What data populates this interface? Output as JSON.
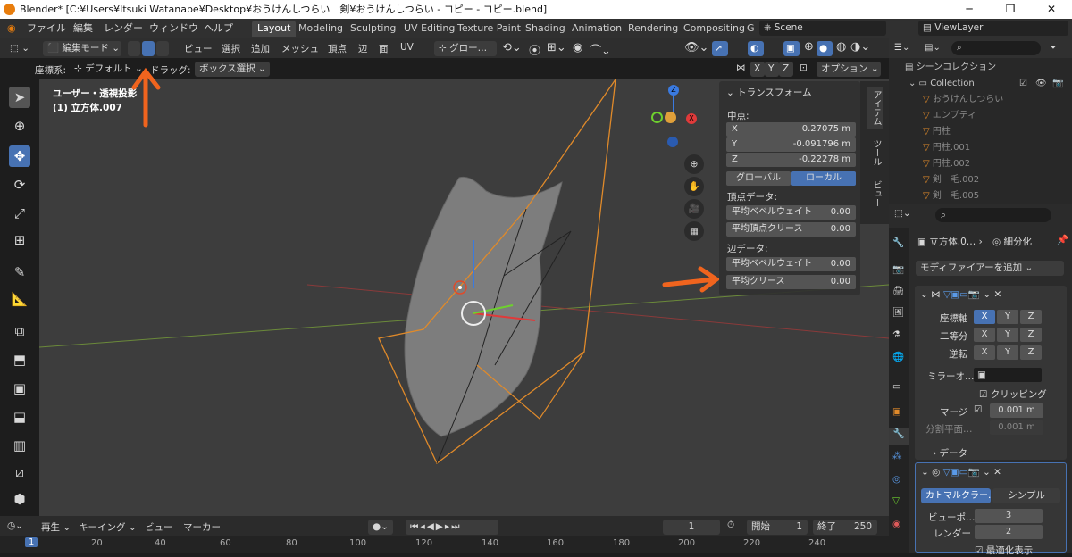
{
  "window": {
    "title": "Blender* [C:¥Users¥Itsuki Watanabe¥Desktop¥おうけんしつらい　剣¥おうけんしつらい - コピー - コピー.blend]",
    "minimize": "─",
    "maximize": "❐",
    "close": "✕"
  },
  "menu": {
    "items": [
      "ファイル",
      "編集",
      "レンダー",
      "ウィンドウ",
      "ヘルプ"
    ],
    "tabs": [
      "Layout",
      "Modeling",
      "Sculpting",
      "UV Editing",
      "Texture Paint",
      "Shading",
      "Animation",
      "Rendering",
      "Compositing",
      "G"
    ],
    "scene": "Scene",
    "view_layer": "ViewLayer"
  },
  "header": {
    "mode": "編集モード",
    "menus": [
      "ビュー",
      "選択",
      "追加",
      "メッシュ",
      "頂点",
      "辺",
      "面",
      "UV"
    ],
    "transform": "グロー…"
  },
  "subheader": {
    "coord_label": "座標系:",
    "coord_value": "デフォルト",
    "drag_label": "ドラッグ:",
    "drag_value": "ボックス選択",
    "axes": [
      "X",
      "Y",
      "Z"
    ],
    "options": "オプション"
  },
  "viewport": {
    "view_name": "ユーザー・透視投影",
    "object_name": "(1) 立方体.007",
    "gizmo": {
      "x": "X",
      "y": "Y",
      "z": "Z"
    }
  },
  "transform_panel": {
    "title": "トランスフォーム",
    "median_label": "中点:",
    "x_label": "X",
    "x": "0.27075 m",
    "y_label": "Y",
    "y": "-0.091796 m",
    "z_label": "Z",
    "z": "-0.22278 m",
    "global": "グローバル",
    "local": "ローカル",
    "vertex_data": "頂点データ:",
    "vert_bevel_label": "平均ベベルウェイト",
    "vert_bevel": "0.00",
    "vert_crease_label": "平均頂点クリース",
    "vert_crease": "0.00",
    "edge_data": "辺データ:",
    "edge_bevel_label": "平均ベベルウェイト",
    "edge_bevel": "0.00",
    "edge_crease_label": "平均クリース",
    "edge_crease": "0.00"
  },
  "side_tabs": [
    "アイテム",
    "ツール",
    "ビュー"
  ],
  "outliner": {
    "scene_collection": "シーンコレクション",
    "collection": "Collection",
    "items": [
      "おうけんしつらい",
      "エンプティ",
      "円柱",
      "円柱.001",
      "円柱.002",
      "剣　毛.002",
      "剣　毛.005"
    ]
  },
  "properties": {
    "object": "立方体.0…",
    "modifier_name": "細分化",
    "add_modifier": "モディファイアーを追加",
    "axis_label": "座標軸",
    "bisect_label": "二等分",
    "flip_label": "逆転",
    "mirror_obj_label": "ミラーオ…",
    "clipping": "クリッピング",
    "merge_label": "マージ",
    "merge": "0.001 m",
    "bisect_dist_label": "分割平面…",
    "bisect_dist": "0.001 m",
    "data_label": "データ",
    "catmull": "カトマルクラー…",
    "simple": "シンプル",
    "viewport_label": "ビューポ…",
    "viewport_levels": "3",
    "render_label": "レンダー",
    "render_levels": "2",
    "optimal": "最適化表示"
  },
  "timeline": {
    "playback": "再生",
    "keying": "キーイング",
    "view": "ビュー",
    "marker": "マーカー",
    "current_frame": "1",
    "start_label": "開始",
    "start": "1",
    "end_label": "終了",
    "end": "250",
    "ticks": [
      "1",
      "20",
      "40",
      "60",
      "80",
      "100",
      "120",
      "140",
      "160",
      "180",
      "200",
      "220",
      "240"
    ]
  }
}
